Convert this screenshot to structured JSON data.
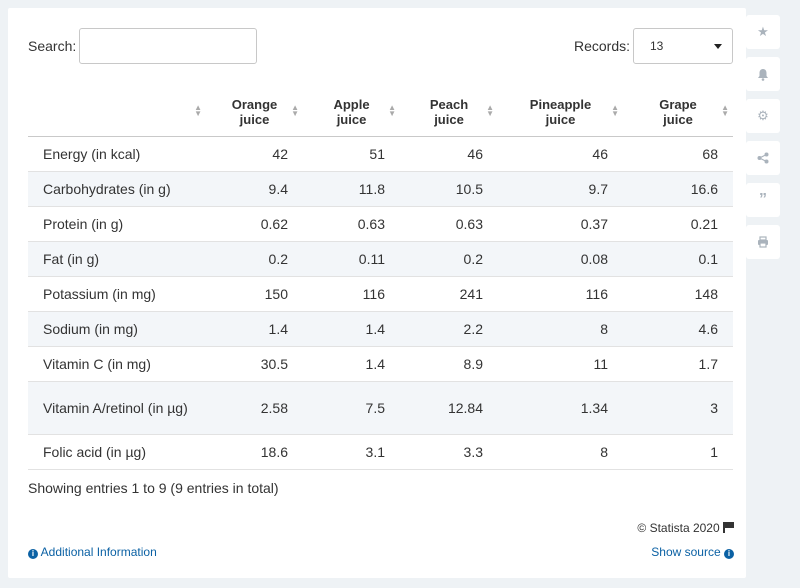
{
  "search": {
    "label": "Search:",
    "value": "",
    "placeholder": ""
  },
  "records": {
    "label": "Records:",
    "value": "13"
  },
  "table": {
    "columns": [
      "",
      "Orange\njuice",
      "Apple\njuice",
      "Peach\njuice",
      "Pineapple\njuice",
      "Grape\njuice"
    ],
    "rows": [
      [
        "Energy (in kcal)",
        "42",
        "51",
        "46",
        "46",
        "68"
      ],
      [
        "Carbohydrates (in g)",
        "9.4",
        "11.8",
        "10.5",
        "9.7",
        "16.6"
      ],
      [
        "Protein (in g)",
        "0.62",
        "0.63",
        "0.63",
        "0.37",
        "0.21"
      ],
      [
        "Fat (in g)",
        "0.2",
        "0.11",
        "0.2",
        "0.08",
        "0.1"
      ],
      [
        "Potassium (in mg)",
        "150",
        "116",
        "241",
        "116",
        "148"
      ],
      [
        "Sodium (in mg)",
        "1.4",
        "1.4",
        "2.2",
        "8",
        "4.6"
      ],
      [
        "Vitamin C (in mg)",
        "30.5",
        "1.4",
        "8.9",
        "11",
        "1.7"
      ],
      [
        "Vitamin A/retinol (in µg)",
        "2.58",
        "7.5",
        "12.84",
        "1.34",
        "3"
      ],
      [
        "Folic acid (in µg)",
        "18.6",
        "3.1",
        "3.3",
        "8",
        "1"
      ]
    ]
  },
  "footer": {
    "entries": "Showing entries 1 to 9 (9 entries in total)",
    "copyright": "© Statista 2020",
    "additional_info": "Additional Information",
    "show_source": "Show source"
  },
  "sidebar": {
    "icons": [
      "star-icon",
      "bell-icon",
      "gear-icon",
      "share-icon",
      "quote-icon",
      "print-icon"
    ]
  }
}
